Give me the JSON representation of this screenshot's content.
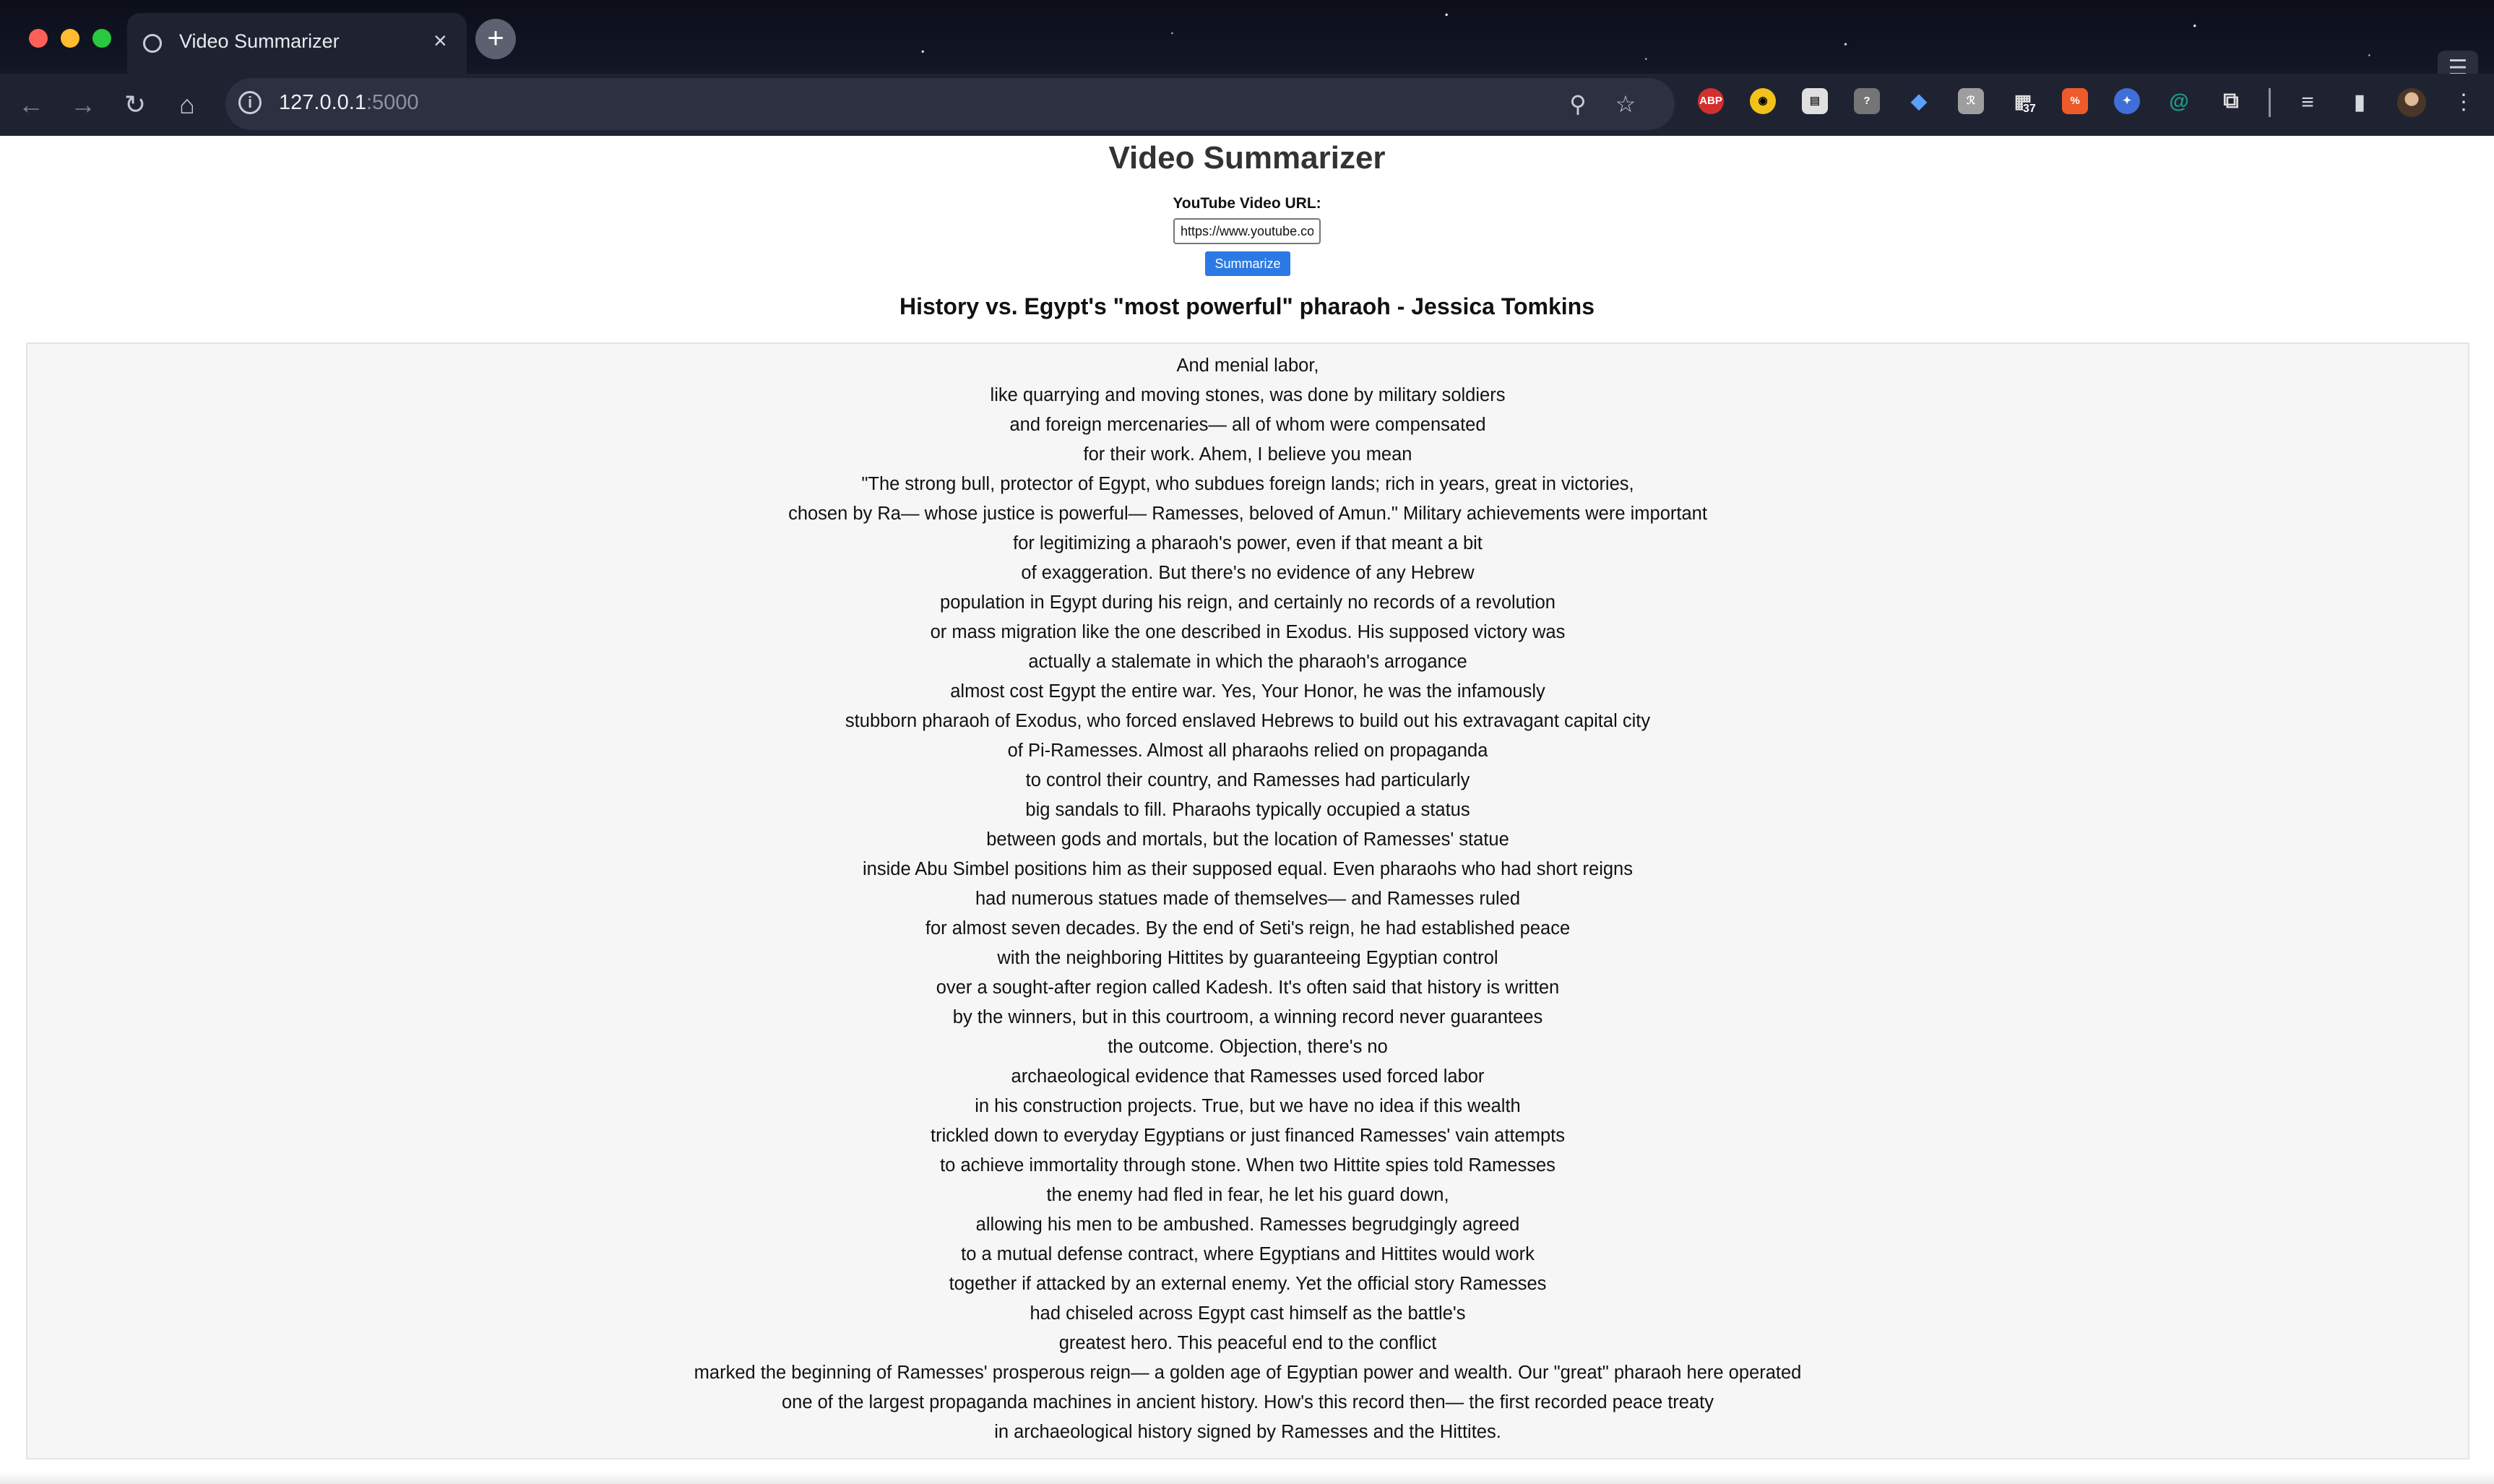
{
  "browser": {
    "tab_title": "Video Summarizer",
    "tab_close": "×",
    "new_tab": "+",
    "url_host": "127.0.0.1",
    "url_port": ":5000",
    "extension_badge": "37"
  },
  "icons": {
    "back": "←",
    "forward": "→",
    "reload": "↻",
    "home": "⌂",
    "site_info": "i",
    "zoom": "⚲",
    "star": "☆",
    "extensions_puzzle": "⧉",
    "queue": "≡",
    "side_panel": "▮",
    "menu": "⋮",
    "strip_menu": "☰"
  },
  "page": {
    "heading": "Video Summarizer",
    "url_label": "YouTube Video URL:",
    "url_value": "https://www.youtube.com/",
    "button_label": "Summarize",
    "video_title": "History vs. Egypt's \"most powerful\" pharaoh - Jessica Tomkins"
  },
  "transcript": [
    "And menial labor,",
    "like quarrying and moving stones, was done by military soldiers",
    "and foreign mercenaries— all of whom were compensated",
    "for their work. Ahem, I believe you mean",
    "\"The strong bull, protector of Egypt, who subdues foreign lands; rich in years, great in victories,",
    "chosen by Ra— whose justice is powerful— Ramesses, beloved of Amun.\" Military achievements were important",
    "for legitimizing a pharaoh's power, even if that meant a bit",
    "of exaggeration. But there's no evidence of any Hebrew",
    "population in Egypt during his reign, and certainly no records of a revolution",
    "or mass migration like the one described in Exodus. His supposed victory was",
    "actually a stalemate in which the pharaoh's arrogance",
    "almost cost Egypt the entire war. Yes, Your Honor, he was the infamously",
    "stubborn pharaoh of Exodus, who forced enslaved Hebrews to build out his extravagant capital city",
    "of Pi-Ramesses. Almost all pharaohs relied on propaganda",
    "to control their country, and Ramesses had particularly",
    "big sandals to fill. Pharaohs typically occupied a status",
    "between gods and mortals, but the location of Ramesses' statue",
    "inside Abu Simbel positions him as their supposed equal. Even pharaohs who had short reigns",
    "had numerous statues made of themselves— and Ramesses ruled",
    "for almost seven decades. By the end of Seti's reign, he had established peace",
    "with the neighboring Hittites by guaranteeing Egyptian control",
    "over a sought-after region called Kadesh. It's often said that history is written",
    "by the winners, but in this courtroom, a winning record never guarantees",
    "the outcome. Objection, there's no",
    "archaeological evidence that Ramesses used forced labor",
    "in his construction projects. True, but we have no idea if this wealth",
    "trickled down to everyday Egyptians or just financed Ramesses' vain attempts",
    "to achieve immortality through stone. When two Hittite spies told Ramesses",
    "the enemy had fled in fear, he let his guard down,",
    "allowing his men to be ambushed. Ramesses begrudgingly agreed",
    "to a mutual defense contract, where Egyptians and Hittites would work",
    "together if attacked by an external enemy. Yet the official story Ramesses",
    "had chiseled across Egypt cast himself as the battle's",
    "greatest hero. This peaceful end to the conflict",
    "marked the beginning of Ramesses' prosperous reign— a golden age of Egyptian power and wealth. Our \"great\" pharaoh here operated",
    "one of the largest propaganda machines in ancient history. How's this record then— the first recorded peace treaty",
    "in archaeological history signed by Ramesses and the Hittites."
  ],
  "colors": {
    "button": "#2b79e4",
    "transcript_bg": "#f6f6f6",
    "toolbar": "#1f2331"
  }
}
